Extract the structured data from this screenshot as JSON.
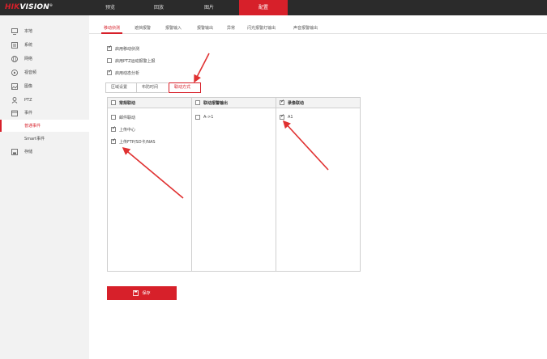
{
  "brand": {
    "hik": "HIK",
    "vision": "VISION",
    "mark": "®"
  },
  "top_nav": [
    {
      "label": "预览"
    },
    {
      "label": "回放"
    },
    {
      "label": "图片"
    },
    {
      "label": "配置",
      "active": true
    }
  ],
  "sidebar": {
    "items": [
      {
        "label": "本地",
        "icon": "monitor-icon"
      },
      {
        "label": "系统",
        "icon": "system-icon"
      },
      {
        "label": "网络",
        "icon": "globe-icon"
      },
      {
        "label": "视音频",
        "icon": "video-audio-icon"
      },
      {
        "label": "图像",
        "icon": "image-icon"
      },
      {
        "label": "PTZ",
        "icon": "ptz-icon"
      },
      {
        "label": "事件",
        "icon": "event-icon"
      },
      {
        "label": "普通事件",
        "icon": "",
        "active": true
      },
      {
        "label": "Smart事件",
        "icon": ""
      },
      {
        "label": "存储",
        "icon": "storage-icon"
      }
    ]
  },
  "subtabs": [
    {
      "label": "移动侦测",
      "active": true
    },
    {
      "label": "遮挡报警"
    },
    {
      "label": "报警输入"
    },
    {
      "label": "报警输出"
    },
    {
      "label": "异常"
    },
    {
      "label": "闪光报警灯输出"
    },
    {
      "label": "声音报警输出"
    }
  ],
  "options": [
    {
      "label": "启用移动侦测",
      "checked": true
    },
    {
      "label": "启用PTZ运动报警上报",
      "checked": false
    },
    {
      "label": "启用动态分析",
      "checked": true
    }
  ],
  "inner_tabs": [
    {
      "label": "区域设置"
    },
    {
      "label": "布防时间"
    },
    {
      "label": "联动方式",
      "active": true
    }
  ],
  "columns": [
    {
      "header": "常规联动",
      "header_checked": false,
      "rows": [
        {
          "label": "邮件联动",
          "checked": false
        },
        {
          "label": "上传中心",
          "checked": true
        },
        {
          "label": "上传FTP/SD卡/NAS",
          "checked": true
        }
      ]
    },
    {
      "header": "联动报警输出",
      "header_checked": false,
      "rows": [
        {
          "label": "A->1",
          "checked": false
        }
      ]
    },
    {
      "header": "录像联动",
      "header_checked": true,
      "rows": [
        {
          "label": "A1",
          "checked": true
        }
      ]
    }
  ],
  "save_button": {
    "label": "保存"
  },
  "colors": {
    "accent": "#d7202a",
    "topbar": "#2b2b2b"
  }
}
